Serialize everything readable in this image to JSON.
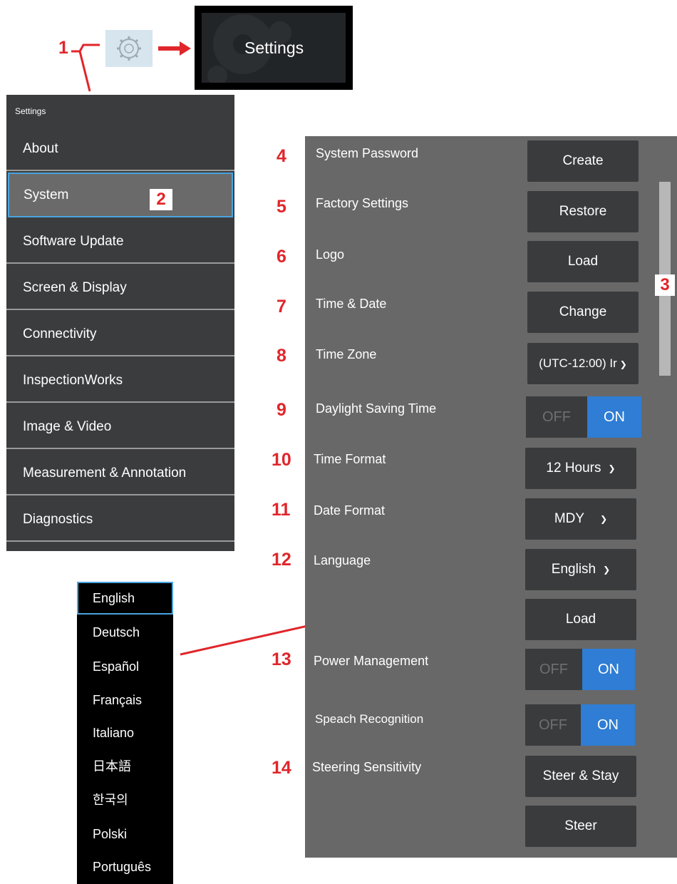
{
  "callouts": {
    "c1": "1",
    "c2": "2",
    "c3": "3",
    "c4": "4",
    "c5": "5",
    "c6": "6",
    "c7": "7",
    "c8": "8",
    "c9": "9",
    "c10": "10",
    "c11": "11",
    "c12": "12",
    "c13": "13",
    "c14": "14"
  },
  "tile": {
    "label": "Settings"
  },
  "menu": {
    "header": "Settings",
    "items": [
      {
        "label": "About"
      },
      {
        "label": "System",
        "selected": true
      },
      {
        "label": "Software Update"
      },
      {
        "label": "Screen & Display"
      },
      {
        "label": "Connectivity"
      },
      {
        "label": "InspectionWorks"
      },
      {
        "label": "Image & Video"
      },
      {
        "label": "Measurement & Annotation"
      },
      {
        "label": "Diagnostics"
      }
    ]
  },
  "system": {
    "password": {
      "label": "System Password",
      "button": "Create"
    },
    "factory": {
      "label": "Factory Settings",
      "button": "Restore"
    },
    "logo": {
      "label": "Logo",
      "button": "Load"
    },
    "timedate": {
      "label": "Time & Date",
      "button": "Change"
    },
    "timezone": {
      "label": "Time Zone",
      "value": "(UTC-12:00) Ir"
    },
    "dst": {
      "label": "Daylight Saving Time",
      "off": "OFF",
      "on": "ON",
      "state": "on"
    },
    "timeformat": {
      "label": "Time Format",
      "value": "12 Hours"
    },
    "dateformat": {
      "label": "Date Format",
      "value": "MDY"
    },
    "language": {
      "label": "Language",
      "value": "English",
      "load_button": "Load"
    },
    "power": {
      "label": "Power Management",
      "off": "OFF",
      "on": "ON",
      "state": "on"
    },
    "speech": {
      "label": "Speach Recognition",
      "off": "OFF",
      "on": "ON",
      "state": "on"
    },
    "steering": {
      "label": "Steering Sensitivity",
      "button1": "Steer & Stay",
      "button2": "Steer"
    }
  },
  "languages": [
    {
      "label": "English",
      "selected": true
    },
    {
      "label": "Deutsch"
    },
    {
      "label": "Español"
    },
    {
      "label": "Français"
    },
    {
      "label": "Italiano"
    },
    {
      "label": "日本語"
    },
    {
      "label": "한국의"
    },
    {
      "label": "Polski"
    },
    {
      "label": "Português"
    }
  ],
  "colors": {
    "accent": "#2f7dd4",
    "callout": "#e0262b",
    "panel": "#686868",
    "menu": "#3b3c3e",
    "selection": "#4aa3df"
  }
}
